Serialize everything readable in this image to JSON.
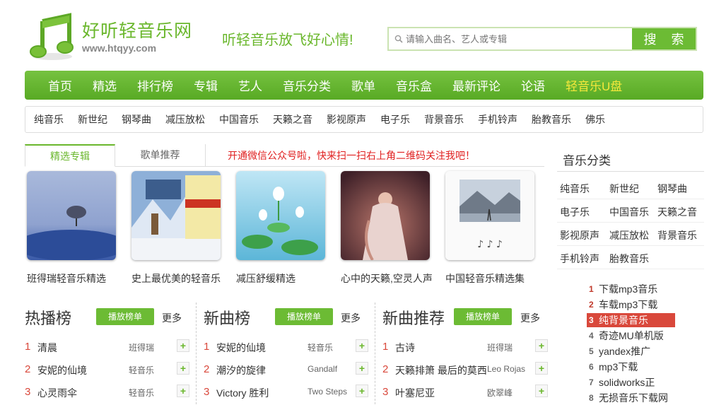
{
  "header": {
    "site_name": "好听轻音乐网",
    "site_url": "www.htqyy.com",
    "slogan": "听轻音乐放飞好心情!",
    "search": {
      "placeholder": "请输入曲名、艺人或专辑",
      "value": "",
      "button_label": "搜 索"
    }
  },
  "main_nav": [
    {
      "label": "首页"
    },
    {
      "label": "精选"
    },
    {
      "label": "排行榜"
    },
    {
      "label": "专辑"
    },
    {
      "label": "艺人"
    },
    {
      "label": "音乐分类"
    },
    {
      "label": "歌单"
    },
    {
      "label": "音乐盒"
    },
    {
      "label": "最新评论"
    },
    {
      "label": "论语"
    },
    {
      "label": "轻音乐U盘"
    }
  ],
  "sub_nav": [
    "纯音乐",
    "新世纪",
    "钢琴曲",
    "减压放松",
    "中国音乐",
    "天籁之音",
    "影视原声",
    "电子乐",
    "背景音乐",
    "手机铃声",
    "胎教音乐",
    "佛乐"
  ],
  "tabs": {
    "featured": "精选专辑",
    "playlist": "歌单推荐"
  },
  "notice": "开通微信公众号啦，快来扫一扫右上角二维码关注我吧！",
  "albums": [
    {
      "title": "班得瑞轻音乐精选"
    },
    {
      "title": "史上最优美的轻音乐"
    },
    {
      "title": "减压舒缓精选"
    },
    {
      "title": "心中的天籁,空灵人声"
    },
    {
      "title": "中国轻音乐精选集"
    }
  ],
  "sidebar": {
    "title": "音乐分类",
    "categories": [
      "纯音乐",
      "新世纪",
      "钢琴曲",
      "电子乐",
      "中国音乐",
      "天籁之音",
      "影视原声",
      "减压放松",
      "背景音乐",
      "手机铃声",
      "胎教音乐"
    ],
    "rank": [
      {
        "num": "1",
        "label": "下载mp3音乐"
      },
      {
        "num": "2",
        "label": "车载mp3下载"
      },
      {
        "num": "3",
        "label": "纯背景音乐"
      },
      {
        "num": "4",
        "label": "奇迹MU单机版"
      },
      {
        "num": "5",
        "label": "yandex推广"
      },
      {
        "num": "6",
        "label": "mp3下载"
      },
      {
        "num": "7",
        "label": "solidworks正"
      },
      {
        "num": "8",
        "label": "无损音乐下载网"
      }
    ]
  },
  "sections": [
    {
      "title": "热播榜",
      "button": "播放榜单",
      "more": "更多",
      "rows": [
        {
          "num": "1",
          "title": "清晨",
          "artist": "班得瑞"
        },
        {
          "num": "2",
          "title": "安妮的仙境",
          "artist": "轻音乐"
        },
        {
          "num": "3",
          "title": "心灵雨伞",
          "artist": "轻音乐"
        }
      ]
    },
    {
      "title": "新曲榜",
      "button": "播放榜单",
      "more": "更多",
      "rows": [
        {
          "num": "1",
          "title": "安妮的仙境",
          "artist": "轻音乐"
        },
        {
          "num": "2",
          "title": "潮汐的旋律",
          "artist": "Gandalf"
        },
        {
          "num": "3",
          "title": "Victory 胜利",
          "artist": "Two Steps"
        }
      ]
    },
    {
      "title": "新曲推荐",
      "button": "播放榜单",
      "more": "更多",
      "rows": [
        {
          "num": "1",
          "title": "古诗",
          "artist": "班得瑞"
        },
        {
          "num": "2",
          "title": "天籁排箫 最后的莫西",
          "artist": "Leo Rojas"
        },
        {
          "num": "3",
          "title": "叶塞尼亚",
          "artist": "欧翠峰"
        }
      ]
    }
  ],
  "colors": {
    "brand_green": "#6ab72c",
    "nav_green": "#5dae28",
    "highlight_yellow": "#f5e83b",
    "alert_red": "#e02020",
    "rank_active": "#d9483b"
  },
  "add_label": "+"
}
